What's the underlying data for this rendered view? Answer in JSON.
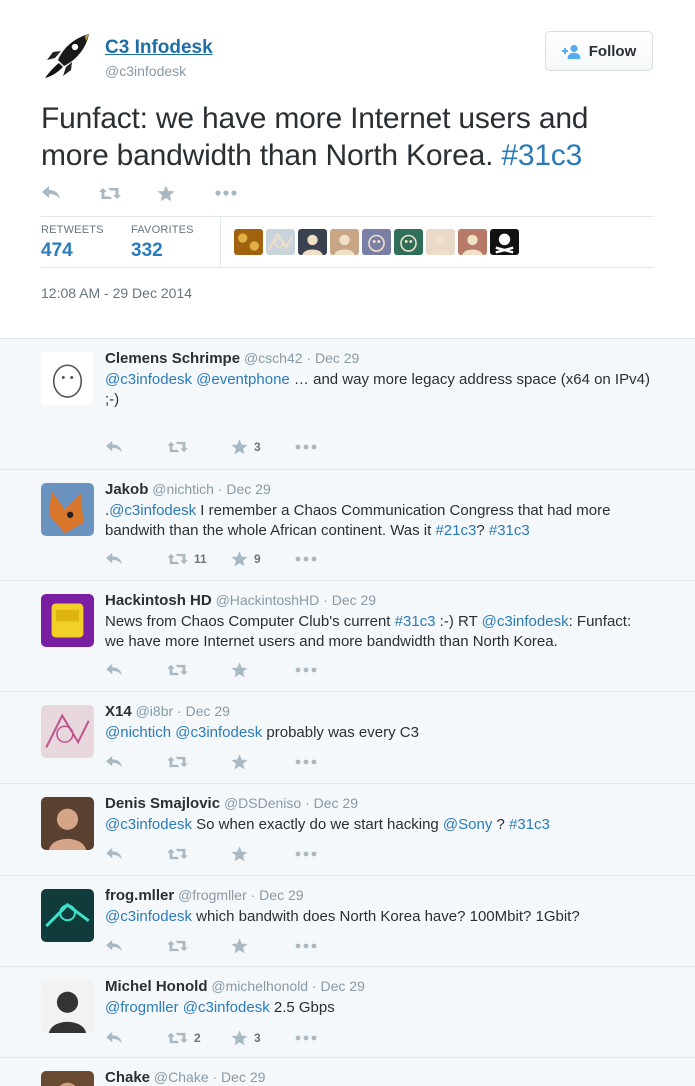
{
  "tweet": {
    "author_name": "C3 Infodesk",
    "author_handle": "@c3infodesk",
    "follow_label": "Follow",
    "text": "Funfact: we have more Internet users and more  bandwidth than North Korea. ",
    "hashtag": "#31c3",
    "retweets_label": "RETWEETS",
    "retweets": "474",
    "favorites_label": "FAVORITES",
    "favorites": "332",
    "timestamp": "12:08 AM - 29 Dec 2014",
    "favoriters": [
      {
        "color": "#a0620f",
        "icon": "pattern-avatar"
      },
      {
        "color": "#c9d3dc",
        "icon": "sketch-avatar"
      },
      {
        "color": "#3a4250",
        "icon": "person-avatar"
      },
      {
        "color": "#c8a585",
        "icon": "person-avatar"
      },
      {
        "color": "#7a7fa6",
        "icon": "cartoon-avatar"
      },
      {
        "color": "#2f6f5a",
        "icon": "creature-avatar"
      },
      {
        "color": "#e9d9c9",
        "icon": "person-avatar"
      },
      {
        "color": "#b77a68",
        "icon": "person-avatar"
      },
      {
        "color": "#111111",
        "icon": "skull-crossbones-avatar"
      }
    ]
  },
  "replies": [
    {
      "name": "Clemens Schrimpe",
      "meta": " @csch42 · Dec 29",
      "parts": [
        {
          "t": "@c3infodesk",
          "m": true
        },
        {
          "t": " ",
          "m": false
        },
        {
          "t": "@eventphone",
          "m": true
        },
        {
          "t": " … and way more legacy address space (x64 on IPv4)\n;-)",
          "m": false
        }
      ],
      "retweets": "",
      "favorites": "3",
      "avatar": {
        "bg": "#ffffff",
        "fg": "#555555",
        "icon": "cartoon-avatar"
      }
    },
    {
      "name": "Jakob",
      "meta": " @nichtich · Dec 29",
      "parts": [
        {
          "t": ".",
          "m": false
        },
        {
          "t": "@c3infodesk",
          "m": true
        },
        {
          "t": " I remember a Chaos Communication Congress that had more bandwith than the whole African continent. Was it ",
          "m": false
        },
        {
          "t": "#21c3",
          "m": true
        },
        {
          "t": "? ",
          "m": false
        },
        {
          "t": "#31c3",
          "m": true
        }
      ],
      "retweets": "11",
      "favorites": "9",
      "avatar": {
        "bg": "#6b93c0",
        "fg": "#d9782c",
        "icon": "fox-avatar"
      }
    },
    {
      "name": "Hackintosh HD",
      "meta": " @HackintoshHD · Dec 29",
      "parts": [
        {
          "t": "News from Chaos Computer Club's current ",
          "m": false
        },
        {
          "t": "#31c3",
          "m": true
        },
        {
          "t": " :-) RT ",
          "m": false
        },
        {
          "t": "@c3infodesk",
          "m": true
        },
        {
          "t": ": Funfact: we have more Internet users and more  bandwidth than North Korea.",
          "m": false
        }
      ],
      "retweets": "",
      "favorites": "",
      "avatar": {
        "bg": "#7b1fa2",
        "fg": "#f2d027",
        "icon": "hard-drive-avatar"
      }
    },
    {
      "name": "X14",
      "meta": " @i8br · Dec 29",
      "parts": [
        {
          "t": "@nichtich",
          "m": true
        },
        {
          "t": " ",
          "m": false
        },
        {
          "t": "@c3infodesk",
          "m": true
        },
        {
          "t": " probably was every C3",
          "m": false
        }
      ],
      "retweets": "",
      "favorites": "",
      "avatar": {
        "bg": "#e8d8de",
        "fg": "#c0508a",
        "icon": "sketch-avatar"
      }
    },
    {
      "name": "Denis Smajlovic",
      "meta": " @DSDeniso · Dec 29",
      "parts": [
        {
          "t": "@c3infodesk",
          "m": true
        },
        {
          "t": " So when exactly do we start hacking ",
          "m": false
        },
        {
          "t": "@Sony",
          "m": true
        },
        {
          "t": " ? ",
          "m": false
        },
        {
          "t": "#31c3",
          "m": true
        }
      ],
      "retweets": "",
      "favorites": "",
      "avatar": {
        "bg": "#5a4030",
        "fg": "#d6a487",
        "icon": "person-avatar"
      }
    },
    {
      "name": "frog.mller",
      "meta": " @frogmller · Dec 29",
      "parts": [
        {
          "t": "@c3infodesk",
          "m": true
        },
        {
          "t": " which bandwith does North Korea have? 100Mbit? 1Gbit?",
          "m": false
        }
      ],
      "retweets": "",
      "favorites": "",
      "avatar": {
        "bg": "#0f3b3a",
        "fg": "#3fe0c8",
        "icon": "circuit-avatar"
      }
    },
    {
      "name": "Michel Honold",
      "meta": " @michelhonold · Dec 29",
      "parts": [
        {
          "t": "@frogmller",
          "m": true
        },
        {
          "t": " ",
          "m": false
        },
        {
          "t": "@c3infodesk",
          "m": true
        },
        {
          "t": " 2.5 Gbps",
          "m": false
        }
      ],
      "retweets": "2",
      "favorites": "3",
      "avatar": {
        "bg": "#f2f2f2",
        "fg": "#333333",
        "icon": "person-avatar"
      }
    },
    {
      "name": "Chake",
      "meta": " @Chake · Dec 29",
      "parts": [],
      "retweets": "",
      "favorites": "",
      "avatar": {
        "bg": "#6b4a33",
        "fg": "#d0a080",
        "icon": "person-avatar"
      }
    }
  ],
  "colors": {
    "link": "#2b7bb9",
    "icon": "#aab8c2",
    "meta": "#8899a6"
  }
}
